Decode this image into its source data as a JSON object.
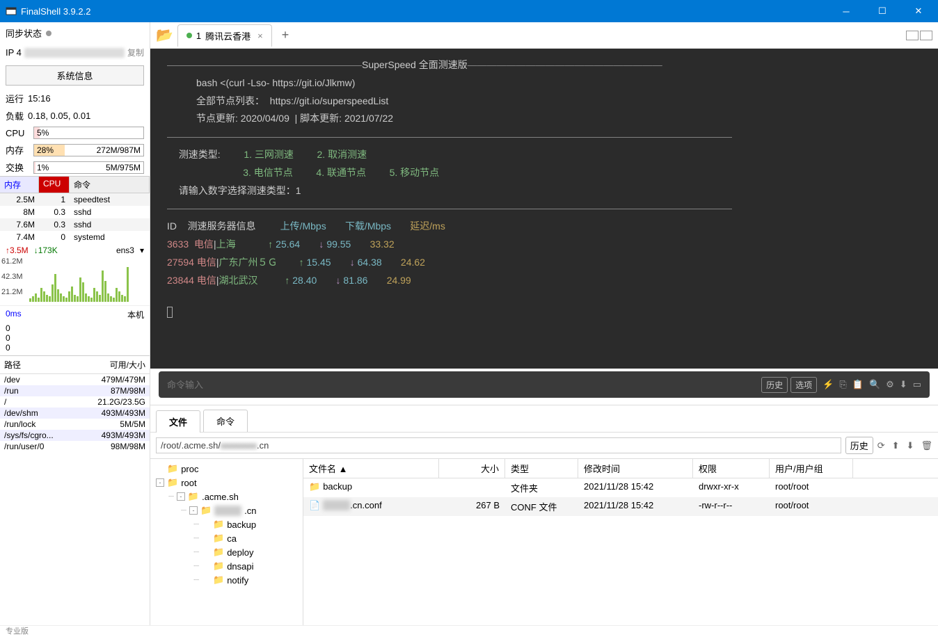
{
  "app": {
    "title": "FinalShell 3.9.2.2"
  },
  "sidebar": {
    "sync_label": "同步状态",
    "ip_label": "IP 4",
    "copy": "复制",
    "sysinfo": "系统信息",
    "uptime_label": "运行",
    "uptime": "15:16",
    "load_label": "负载",
    "load": "0.18, 0.05, 0.01",
    "cpu_label": "CPU",
    "cpu_pct": "5%",
    "mem_label": "内存",
    "mem_pct": "28%",
    "mem_val": "272M/987M",
    "swap_label": "交换",
    "swap_pct": "1%",
    "swap_val": "5M/975M",
    "proc_headers": {
      "mem": "内存",
      "cpu": "CPU",
      "cmd": "命令"
    },
    "procs": [
      {
        "m": "2.5M",
        "c": "1",
        "n": "speedtest"
      },
      {
        "m": "8M",
        "c": "0.3",
        "n": "sshd"
      },
      {
        "m": "7.6M",
        "c": "0.3",
        "n": "sshd"
      },
      {
        "m": "7.4M",
        "c": "0",
        "n": "systemd"
      }
    ],
    "net": {
      "up": "3.5M",
      "down": "173K",
      "if": "ens3"
    },
    "chart_labels": [
      "61.2M",
      "42.3M",
      "21.2M"
    ],
    "ping_ms": "0ms",
    "ping_local": "本机",
    "zeros": [
      "0",
      "0",
      "0"
    ],
    "path_header": {
      "path": "路径",
      "size": "可用/大小"
    },
    "paths": [
      {
        "p": "/dev",
        "s": "479M/479M"
      },
      {
        "p": "/run",
        "s": "87M/98M"
      },
      {
        "p": "/",
        "s": "21.2G/23.5G"
      },
      {
        "p": "/dev/shm",
        "s": "493M/493M"
      },
      {
        "p": "/run/lock",
        "s": "5M/5M"
      },
      {
        "p": "/sys/fs/cgro...",
        "s": "493M/493M"
      },
      {
        "p": "/run/user/0",
        "s": "98M/98M"
      }
    ]
  },
  "tabs": {
    "t1_num": "1",
    "t1_name": "腾讯云香港"
  },
  "terminal": {
    "title": "SuperSpeed 全面测速版",
    "bash": "bash <(curl -Lso- https://git.io/Jlkmw)",
    "list": "全部节点列表：  https://git.io/superspeedList",
    "update": "节点更新: 2020/04/09  | 脚本更新: 2021/07/22",
    "type_label": "测速类型:",
    "opts": {
      "o1": "1. 三网测速",
      "o2": "2. 取消测速",
      "o3": "3. 电信节点",
      "o4": "4. 联通节点",
      "o5": "5. 移动节点"
    },
    "prompt": "请输入数字选择测速类型：1",
    "cols": {
      "id": "ID",
      "server": "测速服务器信息",
      "up": "上传/Mbps",
      "down": "下载/Mbps",
      "delay": "延迟/ms"
    },
    "rows": [
      {
        "id": "3633",
        "isp": "电信",
        "loc": "上海",
        "up": "25.64",
        "down": "99.55",
        "delay": "33.32"
      },
      {
        "id": "27594",
        "isp": "电信",
        "loc": "广东广州５Ｇ",
        "up": "15.45",
        "down": "64.38",
        "delay": "24.62"
      },
      {
        "id": "23844",
        "isp": "电信",
        "loc": "湖北武汉",
        "up": "28.40",
        "down": "81.86",
        "delay": "24.99"
      }
    ]
  },
  "cmd": {
    "placeholder": "命令输入",
    "history": "历史",
    "options": "选项"
  },
  "filepanel": {
    "tab_file": "文件",
    "tab_cmd": "命令",
    "path_prefix": "/root/.acme.sh/",
    "path_blur": "xxxxxxxx",
    "path_suffix": ".cn",
    "history": "历史",
    "tree": [
      {
        "indent": 0,
        "exp": "",
        "name": "proc"
      },
      {
        "indent": 0,
        "exp": "-",
        "name": "root"
      },
      {
        "indent": 1,
        "exp": "-",
        "name": ".acme.sh"
      },
      {
        "indent": 2,
        "exp": "-",
        "name": "xxxxxx.cn",
        "blur": true
      },
      {
        "indent": 3,
        "exp": "",
        "name": "backup"
      },
      {
        "indent": 3,
        "exp": "",
        "name": "ca"
      },
      {
        "indent": 3,
        "exp": "",
        "name": "deploy"
      },
      {
        "indent": 3,
        "exp": "",
        "name": "dnsapi"
      },
      {
        "indent": 3,
        "exp": "",
        "name": "notify"
      }
    ],
    "cols": {
      "name": "文件名 ▲",
      "size": "大小",
      "type": "类型",
      "date": "修改时间",
      "perm": "权限",
      "user": "用户/用户组"
    },
    "rows": [
      {
        "name": "backup",
        "size": "",
        "type": "文件夹",
        "date": "2021/11/28 15:42",
        "perm": "drwxr-xr-x",
        "user": "root/root",
        "folder": true
      },
      {
        "name_blur": "xxxxxx",
        "name_suffix": ".cn.conf",
        "size": "267 B",
        "type": "CONF 文件",
        "date": "2021/11/28 15:42",
        "perm": "-rw-r--r--",
        "user": "root/root",
        "folder": false
      }
    ]
  },
  "footer": "专业版"
}
